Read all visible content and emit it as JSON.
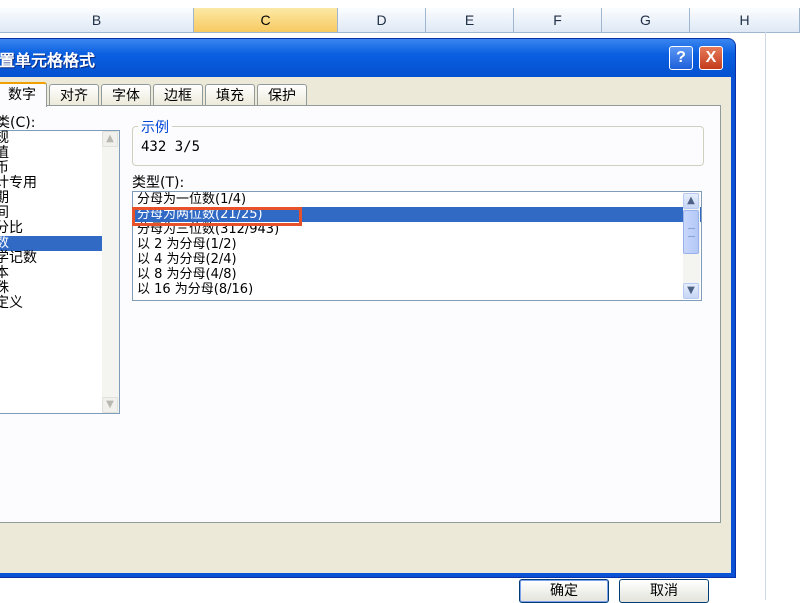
{
  "sheet": {
    "columns": [
      "B",
      "C",
      "D",
      "E",
      "F",
      "G",
      "H"
    ],
    "active_column": "C"
  },
  "dialog": {
    "title": "设置单元格格式",
    "title_visible": "置单元格格式",
    "help_label": "?",
    "close_label": "X",
    "tabs": [
      {
        "label": "数字",
        "active": true
      },
      {
        "label": "对齐",
        "active": false
      },
      {
        "label": "字体",
        "active": false
      },
      {
        "label": "边框",
        "active": false
      },
      {
        "label": "填充",
        "active": false
      },
      {
        "label": "保护",
        "active": false
      }
    ],
    "category_label": "类(C):",
    "categories": [
      "常规",
      "数值",
      "货币",
      "会计专用",
      "日期",
      "时间",
      "百分比",
      "分数",
      "科学记数",
      "文本",
      "特殊",
      "自定义"
    ],
    "categories_visible": [
      "规",
      "值",
      "币",
      "计专用",
      "期",
      "间",
      "分比",
      "数",
      "学记数",
      "本",
      "殊",
      "定义"
    ],
    "selected_category_index": 7,
    "sample": {
      "title": "示例",
      "value": "432  3/5"
    },
    "type_label": "类型(T):",
    "types": [
      "分母为一位数(1/4)",
      "分母为两位数(21/25)",
      "分母为三位数(312/943)",
      "以 2 为分母(1/2)",
      "以 4 为分母(2/4)",
      "以 8 为分母(4/8)",
      "以 16 为分母(8/16)"
    ],
    "selected_type_index": 1,
    "ok_label": "确定",
    "cancel_label": "取消"
  },
  "colors": {
    "title_bar": "#0a5fe0",
    "selection": "#316ac5",
    "highlight_box": "#e8522a",
    "dialog_body": "#ece9d8"
  }
}
